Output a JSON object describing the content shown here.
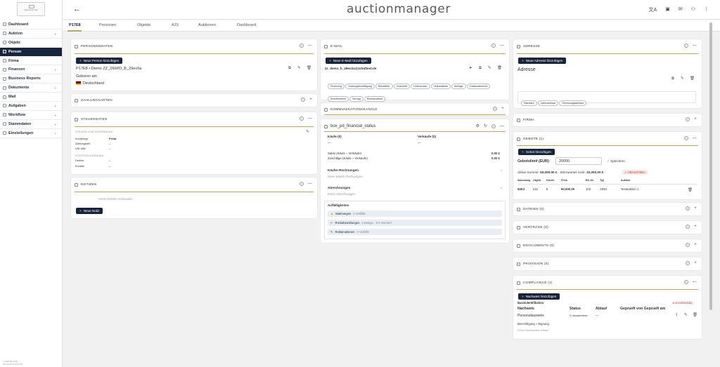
{
  "sidebar": {
    "logo_text": "Upload your logo",
    "items": [
      {
        "label": "Dashboard",
        "icon": "home-icon",
        "chevron": false
      },
      {
        "label": "Auktion",
        "icon": "gavel-icon",
        "chevron": true
      },
      {
        "label": "Objekt",
        "icon": "box-icon",
        "chevron": false
      },
      {
        "label": "Person",
        "icon": "person-icon",
        "chevron": false,
        "active": true
      },
      {
        "label": "Firma",
        "icon": "building-icon",
        "chevron": false
      },
      {
        "label": "Finanzen",
        "icon": "finance-icon",
        "chevron": true
      },
      {
        "label": "Business Reports",
        "icon": "report-icon",
        "chevron": false
      },
      {
        "label": "Dokumente",
        "icon": "document-icon",
        "chevron": true
      },
      {
        "label": "Mail",
        "icon": "mail-icon",
        "chevron": false
      },
      {
        "label": "Aufgaben",
        "icon": "tasks-icon",
        "chevron": true
      },
      {
        "label": "Workflow",
        "icon": "workflow-icon",
        "chevron": true
      },
      {
        "label": "Stammdaten",
        "icon": "database-icon",
        "chevron": true
      },
      {
        "label": "Einstellungen",
        "icon": "gear-icon",
        "chevron": true
      }
    ],
    "footer_line1": "v 2025.09.0759",
    "footer_line2": "API 2025.09.29.0759"
  },
  "topbar": {
    "back": "←",
    "brand": "auctionmanager",
    "icons": [
      "translate-icon",
      "calendar-icon",
      "mail-icon",
      "user-icon",
      "more-icon"
    ]
  },
  "tabs": [
    "P17E8",
    "Personen",
    "Objekte",
    "A15",
    "Auktionen",
    "Dashboard"
  ],
  "personendaten": {
    "title": "PERSONENDATEN",
    "count": "1",
    "add_button": "Neue Person hinzufügen",
    "name": "P17E8 • Demo ZZ_DEMO_B_29ec0a",
    "geboren_label": "Geboren am",
    "country": "Deutschland"
  },
  "zahlungsarten": {
    "title": "ZAHLUNGSARTEN",
    "count": "0"
  },
  "steuerdaten": {
    "title": "STEUERDATEN",
    "count": "1",
    "section1": "STEUERLICHE EINORDNUNG",
    "rows1": [
      {
        "k": "Kundentyp",
        "v": "Privat"
      },
      {
        "k": "Zahlungsziel",
        "v": "–"
      },
      {
        "k": "USt-IdNr.",
        "v": "–"
      }
    ],
    "section2": "KONTENZUORDNUNG",
    "rows2": [
      {
        "k": "Debitor",
        "v": "–"
      },
      {
        "k": "Kreditor",
        "v": "–"
      }
    ]
  },
  "notizen": {
    "title": "NOTIZEN",
    "count": "0",
    "empty": "Keine Notizen vorhanden.",
    "add_button": "Neue Notiz"
  },
  "email": {
    "title": "E-MAIL",
    "count": "1",
    "add_button": "Neue E-Mail hinzufügen",
    "address": "zz_demo_b_29ec0a@zzbidtest.de",
    "chips": [
      "Rechnung",
      "Zahlungsbestätigung",
      "Newsletter",
      "Gutschrift",
      "Lieferschein",
      "Verkaufsliste",
      "Anfrage",
      "Zustandsbericht",
      "Schriftverkehr",
      "Vertrag",
      "Rücksendeart"
    ]
  },
  "kommunikation": {
    "title": "KOMMUNIKATIONSKANÄLE",
    "count": "0"
  },
  "financial": {
    "title": "box_pd_financial_status",
    "count": "0",
    "kaeufe": "Käufe (0)",
    "verkaeufe": "Verkäufe (0)",
    "dash": "—",
    "saldo_label": "Saldo (Käufe – Verkäufe)",
    "saldo_value": "0.00 €",
    "zuschlaege_label": "Zuschläge (Käufe – Verkäufe)",
    "zuschlaege_value": "0.00 €",
    "kaeufer_title": "Käufer-Rechnungen",
    "kaeufer_empty": "Keine Käufer-Rechnungen.",
    "kaeufer_count": "0",
    "abrech_title": "Abrechnungen",
    "abrech_empty": "Keine Abrechnungen.",
    "abrech_count": "0",
    "auff_title": "Auffälligkeiten",
    "auff_rows": [
      {
        "icon": "warning-icon",
        "label": "Mahnungen",
        "count": "0 Vorfälle"
      },
      {
        "icon": "return-icon",
        "label": "Rückabwicklungen",
        "count": "0 Belege · 0 € storniert"
      },
      {
        "icon": "complaint-icon",
        "label": "Reklamationen",
        "count": "0 Vorfälle"
      }
    ]
  },
  "adresse": {
    "title": "ADRESSE",
    "count": "1",
    "add_button": "Neue Adresse hinzufügen",
    "heading": "Adresse",
    "chips": [
      "Standard",
      "Lieferadresse",
      "Rechnungsadresse"
    ]
  },
  "firma": {
    "title": "FIRMA",
    "count": "0"
  },
  "gebote": {
    "title": "GEBOTE (1)",
    "add_button": "Gebot hinzufügen",
    "limit_label": "Gebotslimit (EUR):",
    "limit_value": "20000",
    "save": "Speichern",
    "active_sum_label": "Aktive Summe:",
    "active_sum_value": "60,000.00 €",
    "win_limit_label": "· Winzuames Limit:",
    "win_limit_value": "20,000.00 €",
    "exceeded": "Überschritten",
    "headers": [
      "Sammlung",
      "Objekt",
      "Kat-Nr.",
      "Preis",
      "Bit.-Nr.",
      "Typ",
      "Auktion"
    ],
    "row": [
      "84K2",
      "L51",
      "5",
      "60,000.00",
      "102",
      "AING",
      "Testauktion 1"
    ]
  },
  "dateien": {
    "title": "DATEIEN (0)",
    "count": "0"
  },
  "vertraege": {
    "title": "VERTRÄGE (0)",
    "count": "0"
  },
  "edocuments": {
    "title": "EDOCUMENTS (0)",
    "count": "0"
  },
  "provision": {
    "title": "PROVISION (0)",
    "count": "0"
  },
  "compliance": {
    "title": "COMPLIANCE (1)",
    "add_button": "Nachweis hinzufügen",
    "basis": "Basisidentifikation",
    "status_flag": "Unvollständig",
    "headers": [
      "Nachweis",
      "Status",
      "Ablauf",
      "Geprueft von Geprueft am"
    ],
    "row_nachweis": "Personalausweis",
    "row_status": "Ausstehend",
    "row_ablauf": "—",
    "berechtigung": "Berechtigung + Eignung",
    "empty": "Keine Nachweise erfasst"
  },
  "colors": {
    "navy": "#17253c",
    "gold": "#c8a24a",
    "red": "#cc3333"
  }
}
